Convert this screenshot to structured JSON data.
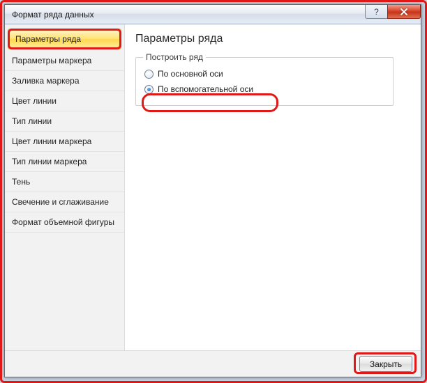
{
  "window": {
    "title": "Формат ряда данных"
  },
  "sidebar": {
    "items": [
      {
        "label": "Параметры ряда",
        "selected": true
      },
      {
        "label": "Параметры маркера"
      },
      {
        "label": "Заливка маркера"
      },
      {
        "label": "Цвет линии"
      },
      {
        "label": "Тип линии"
      },
      {
        "label": "Цвет линии маркера"
      },
      {
        "label": "Тип линии маркера"
      },
      {
        "label": "Тень"
      },
      {
        "label": "Свечение и сглаживание"
      },
      {
        "label": "Формат объемной фигуры"
      }
    ]
  },
  "main": {
    "heading": "Параметры ряда",
    "group_legend": "Построить ряд",
    "radios": [
      {
        "label": "По основной оси",
        "checked": false
      },
      {
        "label": "По вспомогательной оси",
        "checked": true
      }
    ]
  },
  "footer": {
    "close_label": "Закрыть"
  }
}
